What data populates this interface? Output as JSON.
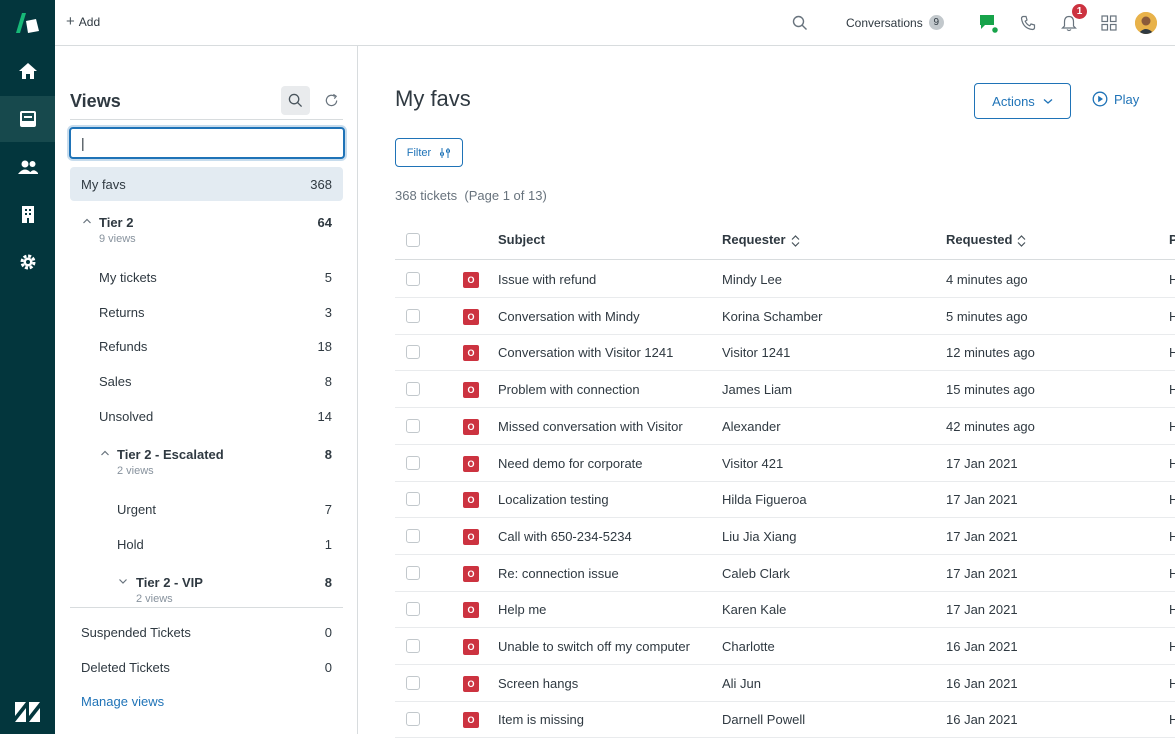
{
  "topbar": {
    "add_label": "Add",
    "conversations_label": "Conversations",
    "conversations_count": "9",
    "notifications_count": "1"
  },
  "views_panel": {
    "title": "Views",
    "search_value": "|",
    "items": [
      {
        "label": "My favs",
        "count": "368"
      },
      {
        "label": "Tier 2",
        "count": "64",
        "sub": "9 views"
      },
      {
        "label": "My tickets",
        "count": "5"
      },
      {
        "label": "Returns",
        "count": "3"
      },
      {
        "label": "Refunds",
        "count": "18"
      },
      {
        "label": "Sales",
        "count": "8"
      },
      {
        "label": "Unsolved",
        "count": "14"
      },
      {
        "label": "Tier 2 - Escalated",
        "count": "8",
        "sub": "2 views"
      },
      {
        "label": "Urgent",
        "count": "7"
      },
      {
        "label": "Hold",
        "count": "1"
      },
      {
        "label": "Tier 2 - VIP",
        "count": "8",
        "sub": "2 views"
      },
      {
        "label": "Suspended Tickets",
        "count": "0"
      },
      {
        "label": "Deleted Tickets",
        "count": "0"
      }
    ],
    "manage_label": "Manage views"
  },
  "main": {
    "title": "My favs",
    "actions_label": "Actions",
    "play_label": "Play",
    "filter_label": "Filter",
    "ticket_count": "368 tickets",
    "page_info": "(Page 1 of 13)",
    "columns": [
      "Subject",
      "Requester",
      "Requested",
      "P"
    ],
    "status_letter": "O",
    "rows": [
      {
        "subject": "Issue with refund",
        "requester": "Mindy Lee",
        "requested": "4 minutes ago",
        "extra": "H"
      },
      {
        "subject": "Conversation with Mindy",
        "requester": "Korina Schamber",
        "requested": "5 minutes ago",
        "extra": "H"
      },
      {
        "subject": "Conversation with Visitor 1241",
        "requester": "Visitor 1241",
        "requested": "12 minutes ago",
        "extra": "H"
      },
      {
        "subject": "Problem with connection",
        "requester": "James Liam",
        "requested": "15 minutes ago",
        "extra": "H"
      },
      {
        "subject": "Missed conversation with Visitor",
        "requester": "Alexander",
        "requested": "42 minutes ago",
        "extra": "H"
      },
      {
        "subject": "Need demo for corporate",
        "requester": "Visitor 421",
        "requested": "17 Jan 2021",
        "extra": "H"
      },
      {
        "subject": "Localization testing",
        "requester": "Hilda Figueroa",
        "requested": "17 Jan 2021",
        "extra": "H"
      },
      {
        "subject": "Call with 650-234-5234",
        "requester": "Liu Jia Xiang",
        "requested": "17 Jan 2021",
        "extra": "H"
      },
      {
        "subject": "Re: connection issue",
        "requester": "Caleb Clark",
        "requested": "17 Jan 2021",
        "extra": "H"
      },
      {
        "subject": "Help me",
        "requester": "Karen Kale",
        "requested": "17 Jan 2021",
        "extra": "H"
      },
      {
        "subject": "Unable to switch off my computer",
        "requester": "Charlotte",
        "requested": "16 Jan 2021",
        "extra": "H"
      },
      {
        "subject": "Screen hangs",
        "requester": "Ali Jun",
        "requested": "16 Jan 2021",
        "extra": "H"
      },
      {
        "subject": "Item is missing",
        "requester": "Darnell Powell",
        "requested": "16 Jan 2021",
        "extra": "H"
      }
    ]
  },
  "colors": {
    "rail": "#03363d",
    "accent": "#1f73b7",
    "status_open": "#cc3340",
    "chat_green": "#17a34a"
  }
}
